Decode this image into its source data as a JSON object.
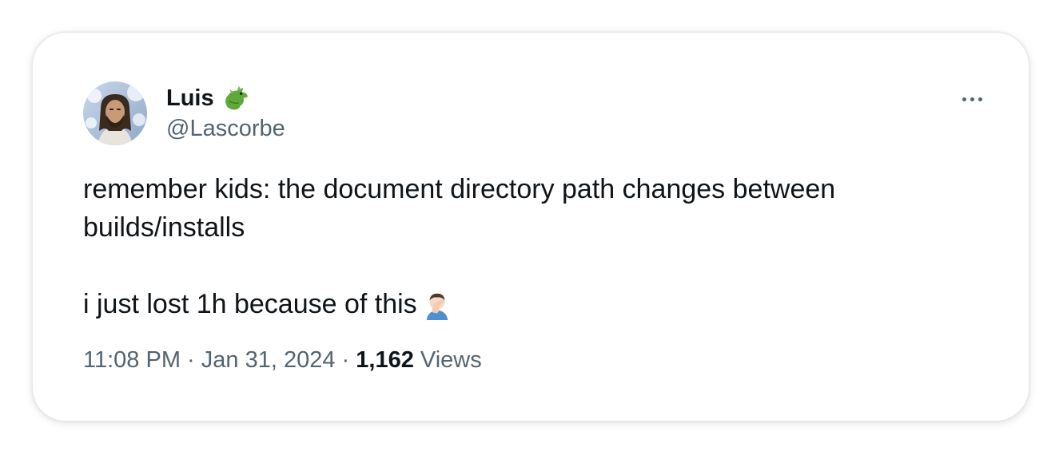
{
  "tweet": {
    "author_name": "Luis",
    "author_handle": "@Lascorbe",
    "text_line1": "remember kids: the document directory path changes between builds/installs",
    "text_line2": "i just lost 1h because of this",
    "time": "11:08 PM",
    "separator": "·",
    "date": "Jan 31, 2024",
    "views_count": "1,162",
    "views_label": "Views"
  },
  "icons": {
    "name_badge": "dragon-emoji-icon",
    "text_emoji": "facepalm-emoji-icon",
    "more": "more-options-icon"
  },
  "colors": {
    "text_primary": "#0f1419",
    "text_secondary": "#536471",
    "card_border": "#e6e9ec"
  }
}
